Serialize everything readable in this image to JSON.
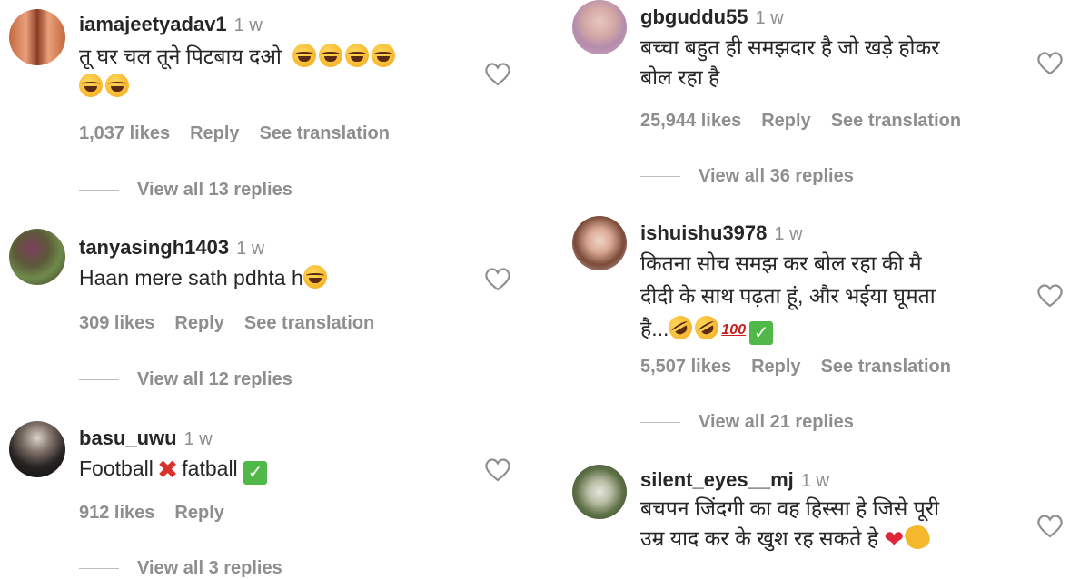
{
  "left": [
    {
      "username": "iamajeetyadav1",
      "time": "1 w",
      "lines": [
        "तू घर चल तूने पिटबाय दओ"
      ],
      "likes": "1,037 likes",
      "reply": "Reply",
      "translate": "See translation",
      "replies": "View all 13 replies"
    },
    {
      "username": "tanyasingh1403",
      "time": "1 w",
      "lines": [
        "Haan mere sath pdhta h"
      ],
      "likes": "309 likes",
      "reply": "Reply",
      "translate": "See translation",
      "replies": "View all 12 replies"
    },
    {
      "username": "basu_uwu",
      "time": "1 w",
      "lines": [
        "Football",
        "fatball"
      ],
      "likes": "912 likes",
      "reply": "Reply",
      "replies": "View all 3 replies"
    }
  ],
  "right": [
    {
      "username": "gbguddu55",
      "time": "1 w",
      "lines": [
        "बच्चा बहुत ही समझदार है जो खड़े होकर",
        "बोल रहा है"
      ],
      "likes": "25,944 likes",
      "reply": "Reply",
      "translate": "See translation",
      "replies": "View all 36 replies"
    },
    {
      "username": "ishuishu3978",
      "time": "1 w",
      "lines": [
        "कितना सोच समझ कर बोल रहा की मै",
        "दीदी के साथ पढ़ता हूं, और भईया घूमता",
        "है..."
      ],
      "likes": "5,507 likes",
      "reply": "Reply",
      "translate": "See translation",
      "replies": "View all 21 replies"
    },
    {
      "username": "silent_eyes__mj",
      "time": "1 w",
      "lines": [
        "बचपन जिंदगी का वह हिस्सा हे जिसे पूरी",
        "उम्र याद कर के खुश रह सकते हे"
      ]
    }
  ],
  "icons": {
    "heart": "heart-outline-icon",
    "laugh": "face-with-tears-of-joy-emoji",
    "rofl": "rolling-on-floor-laughing-emoji",
    "check": "check-mark-emoji",
    "cross": "cross-mark-emoji",
    "hundred": "hundred-points-emoji",
    "red_heart": "red-heart-emoji",
    "clap": "clapping-hands-emoji"
  },
  "colors": {
    "text": "#262626",
    "secondary": "#8e8e8e"
  }
}
